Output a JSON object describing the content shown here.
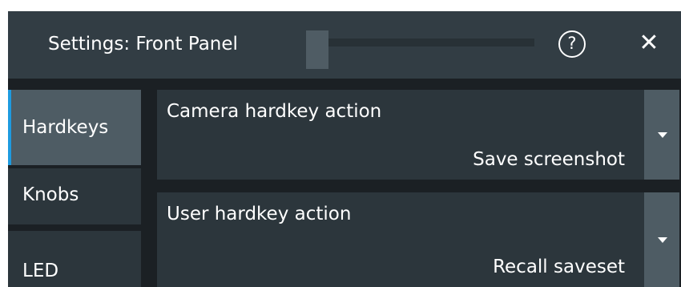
{
  "dialog": {
    "title": "Settings: Front Panel",
    "help_label": "?",
    "close_label": "✕"
  },
  "sidebar": {
    "tabs": [
      {
        "label": "Hardkeys",
        "active": true
      },
      {
        "label": "Knobs",
        "active": false
      },
      {
        "label": "LED",
        "active": false
      }
    ]
  },
  "settings": {
    "camera_hardkey": {
      "label": "Camera hardkey action",
      "value": "Save screenshot"
    },
    "user_hardkey": {
      "label": "User hardkey action",
      "value": "Recall saveset"
    }
  },
  "colors": {
    "accent": "#1e9be0",
    "titlebar": "#323d44",
    "panel": "#2c363c",
    "background": "#1b2024"
  }
}
